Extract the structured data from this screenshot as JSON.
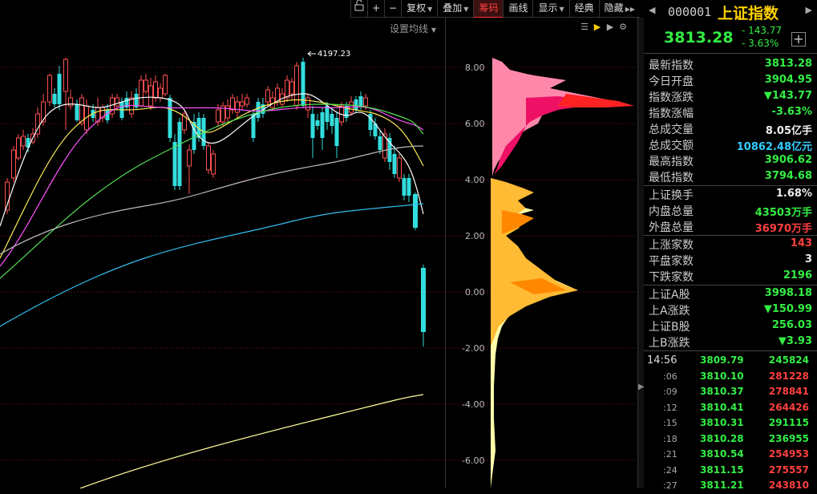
{
  "toolbar": {
    "buttons": [
      {
        "label": "",
        "icon": "lock-icon"
      },
      {
        "label": "+",
        "icon": "zoom-in"
      },
      {
        "label": "−",
        "icon": "zoom-out"
      },
      {
        "label": "复权",
        "dropdown": true
      },
      {
        "label": "叠加",
        "dropdown": true
      },
      {
        "label": "筹码",
        "active": true
      },
      {
        "label": "画线"
      },
      {
        "label": "显示",
        "dropdown": true
      },
      {
        "label": "经典"
      },
      {
        "label": "隐藏",
        "more": true
      }
    ],
    "ma_settings": "设置均线"
  },
  "chart": {
    "peak_label": "4197.23",
    "y_axis": [
      "8.00",
      "6.00",
      "4.00",
      "2.00",
      "0.00",
      "-2.00",
      "-4.00",
      "-6.00"
    ]
  },
  "quote": {
    "code": "000001",
    "name": "上证指数",
    "last": "3813.28",
    "change": "- 143.77",
    "change_pct": "- 3.63%",
    "fields": [
      {
        "key": "最新指数",
        "value": "3813.28",
        "color": "green"
      },
      {
        "key": "今日开盘",
        "value": "3904.95",
        "color": "green"
      },
      {
        "key": "指数涨跌",
        "value": "▼143.77",
        "color": "green"
      },
      {
        "key": "指数涨幅",
        "value": "-3.63%",
        "color": "green"
      },
      {
        "key": "总成交量",
        "value": "8.05亿手",
        "color": "white"
      },
      {
        "key": "总成交额",
        "value": "10862.48亿元",
        "color": "cyan"
      },
      {
        "key": "最高指数",
        "value": "3906.62",
        "color": "green"
      },
      {
        "key": "最低指数",
        "value": "3794.68",
        "color": "green"
      }
    ],
    "fields2": [
      {
        "key": "上证换手",
        "value": "1.68%",
        "color": "white"
      },
      {
        "key": "内盘总量",
        "value": "43503万手",
        "color": "green"
      },
      {
        "key": "外盘总量",
        "value": "36970万手",
        "color": "red"
      }
    ],
    "fields3": [
      {
        "key": "上涨家数",
        "value": "143",
        "color": "red"
      },
      {
        "key": "平盘家数",
        "value": "3",
        "color": "white"
      },
      {
        "key": "下跌家数",
        "value": "2196",
        "color": "green"
      }
    ],
    "fields4": [
      {
        "key": "上证A股",
        "value": "3998.18",
        "color": "green"
      },
      {
        "key": "上A涨跌",
        "value": "▼150.99",
        "color": "green"
      },
      {
        "key": "上证B股",
        "value": "256.03",
        "color": "green"
      },
      {
        "key": "上B涨跌",
        "value": "▼3.93",
        "color": "green"
      }
    ],
    "ticks": [
      {
        "time": "14:56",
        "price": "3809.79",
        "vol": "245824",
        "vcolor": "green",
        "full": true
      },
      {
        "time": ":06",
        "price": "3810.10",
        "vol": "281228",
        "vcolor": "red"
      },
      {
        "time": ":09",
        "price": "3810.37",
        "vol": "278841",
        "vcolor": "red"
      },
      {
        "time": ":12",
        "price": "3810.41",
        "vol": "264426",
        "vcolor": "red"
      },
      {
        "time": ":15",
        "price": "3810.31",
        "vol": "291115",
        "vcolor": "green"
      },
      {
        "time": ":18",
        "price": "3810.28",
        "vol": "236955",
        "vcolor": "green"
      },
      {
        "time": ":21",
        "price": "3810.54",
        "vol": "254953",
        "vcolor": "red"
      },
      {
        "time": ":24",
        "price": "3811.15",
        "vol": "275557",
        "vcolor": "red"
      },
      {
        "time": ":27",
        "price": "3811.21",
        "vol": "243810",
        "vcolor": "red"
      }
    ]
  }
}
